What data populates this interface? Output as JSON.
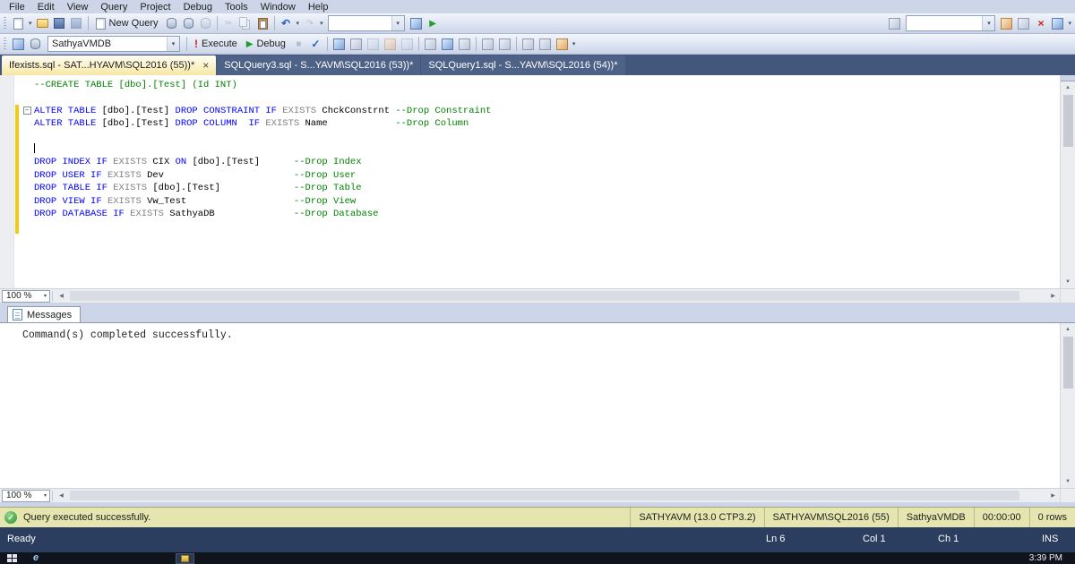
{
  "menu": {
    "items": [
      "File",
      "Edit",
      "View",
      "Query",
      "Project",
      "Debug",
      "Tools",
      "Window",
      "Help"
    ]
  },
  "icons": {
    "dropdown_caret": "▾",
    "undo": "↶",
    "redo": "↷",
    "play": "▶",
    "stop": "■",
    "check": "✓",
    "execute_exclaim": "!",
    "cut": "✂",
    "close": "×",
    "collapse_minus": "−",
    "scroll_up": "▲",
    "scroll_down": "▼",
    "scroll_left": "◀",
    "scroll_right": "▶",
    "success_check": "✓",
    "ie_e": "e"
  },
  "toolbar_standard": {
    "new_query_label": "New Query"
  },
  "toolbar_sql": {
    "database_combo": "SathyaVMDB",
    "execute_label": "Execute",
    "debug_label": "Debug"
  },
  "tabs": [
    {
      "label": "Ifexists.sql - SAT...HYAVM\\SQL2016 (55))*",
      "active": true
    },
    {
      "label": "SQLQuery3.sql - S...YAVM\\SQL2016 (53))*",
      "active": false
    },
    {
      "label": "SQLQuery1.sql - S...YAVM\\SQL2016 (54))*",
      "active": false
    }
  ],
  "editor": {
    "zoom": "100 %",
    "lines": [
      {
        "tokens": [
          {
            "t": "--CREATE TABLE [dbo].[Test] (Id INT)",
            "c": "comment"
          }
        ]
      },
      {
        "tokens": []
      },
      {
        "collapse": true,
        "changed": true,
        "tokens": [
          {
            "t": "ALTER TABLE",
            "c": "kw"
          },
          {
            "t": " [dbo].[Test] ",
            "c": "plain"
          },
          {
            "t": "DROP CONSTRAINT",
            "c": "kw"
          },
          {
            "t": " ",
            "c": "plain"
          },
          {
            "t": "IF",
            "c": "kw"
          },
          {
            "t": " ",
            "c": "plain"
          },
          {
            "t": "EXISTS",
            "c": "gray"
          },
          {
            "t": " ChckConstrnt ",
            "c": "plain"
          },
          {
            "t": "--Drop Constraint",
            "c": "comment"
          }
        ]
      },
      {
        "changed": true,
        "tokens": [
          {
            "t": "ALTER TABLE",
            "c": "kw"
          },
          {
            "t": " [dbo].[Test] ",
            "c": "plain"
          },
          {
            "t": "DROP COLUMN",
            "c": "kw"
          },
          {
            "t": "  ",
            "c": "plain"
          },
          {
            "t": "IF",
            "c": "kw"
          },
          {
            "t": " ",
            "c": "plain"
          },
          {
            "t": "EXISTS",
            "c": "gray"
          },
          {
            "t": " Name            ",
            "c": "plain"
          },
          {
            "t": "--Drop Column",
            "c": "comment"
          }
        ]
      },
      {
        "changed": true,
        "tokens": []
      },
      {
        "changed": true,
        "caret": true,
        "tokens": []
      },
      {
        "changed": true,
        "tokens": [
          {
            "t": "DROP INDEX",
            "c": "kw"
          },
          {
            "t": " ",
            "c": "plain"
          },
          {
            "t": "IF",
            "c": "kw"
          },
          {
            "t": " ",
            "c": "plain"
          },
          {
            "t": "EXISTS",
            "c": "gray"
          },
          {
            "t": " CIX ",
            "c": "plain"
          },
          {
            "t": "ON",
            "c": "kw"
          },
          {
            "t": " [dbo].[Test]      ",
            "c": "plain"
          },
          {
            "t": "--Drop Index",
            "c": "comment"
          }
        ]
      },
      {
        "changed": true,
        "tokens": [
          {
            "t": "DROP USER",
            "c": "kw"
          },
          {
            "t": " ",
            "c": "plain"
          },
          {
            "t": "IF",
            "c": "kw"
          },
          {
            "t": " ",
            "c": "plain"
          },
          {
            "t": "EXISTS",
            "c": "gray"
          },
          {
            "t": " Dev                       ",
            "c": "plain"
          },
          {
            "t": "--Drop User",
            "c": "comment"
          }
        ]
      },
      {
        "changed": true,
        "tokens": [
          {
            "t": "DROP TABLE",
            "c": "kw"
          },
          {
            "t": " ",
            "c": "plain"
          },
          {
            "t": "IF",
            "c": "kw"
          },
          {
            "t": " ",
            "c": "plain"
          },
          {
            "t": "EXISTS",
            "c": "gray"
          },
          {
            "t": " [dbo].[Test]             ",
            "c": "plain"
          },
          {
            "t": "--Drop Table",
            "c": "comment"
          }
        ]
      },
      {
        "changed": true,
        "tokens": [
          {
            "t": "DROP VIEW",
            "c": "kw"
          },
          {
            "t": " ",
            "c": "plain"
          },
          {
            "t": "IF",
            "c": "kw"
          },
          {
            "t": " ",
            "c": "plain"
          },
          {
            "t": "EXISTS",
            "c": "gray"
          },
          {
            "t": " Vw_Test                   ",
            "c": "plain"
          },
          {
            "t": "--Drop View",
            "c": "comment"
          }
        ]
      },
      {
        "changed": true,
        "tokens": [
          {
            "t": "DROP DATABASE",
            "c": "kw"
          },
          {
            "t": " ",
            "c": "plain"
          },
          {
            "t": "IF",
            "c": "kw"
          },
          {
            "t": " ",
            "c": "plain"
          },
          {
            "t": "EXISTS",
            "c": "gray"
          },
          {
            "t": " SathyaDB              ",
            "c": "plain"
          },
          {
            "t": "--Drop Database",
            "c": "comment"
          }
        ]
      },
      {
        "changed": true,
        "tokens": []
      }
    ]
  },
  "messages": {
    "tab_label": "Messages",
    "text": "Command(s) completed successfully.",
    "zoom": "100 %"
  },
  "exec_status": {
    "message": "Query executed successfully.",
    "server": "SATHYAVM (13.0 CTP3.2)",
    "connection": "SATHYAVM\\SQL2016 (55)",
    "database": "SathyaVMDB",
    "duration": "00:00:00",
    "rows": "0 rows"
  },
  "status_bar": {
    "state": "Ready",
    "line": "Ln 6",
    "column": "Col 1",
    "char": "Ch 1",
    "mode": "INS"
  },
  "taskbar": {
    "clock": "3:39 PM"
  }
}
